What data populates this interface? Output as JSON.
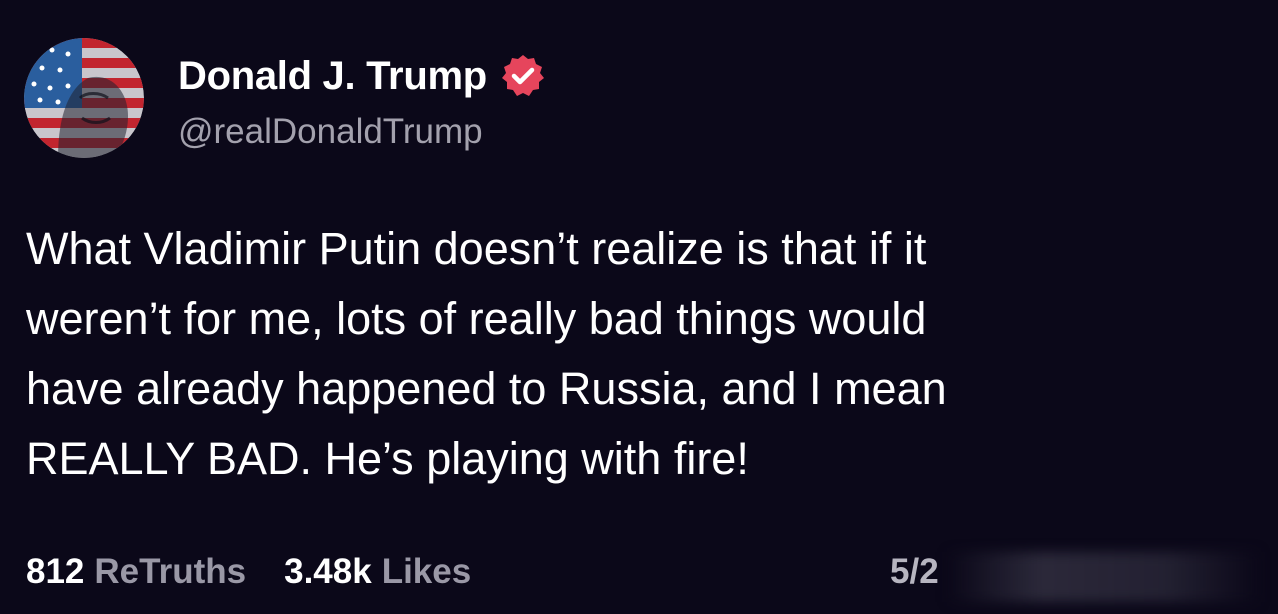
{
  "author": {
    "display_name": "Donald J. Trump",
    "handle": "@realDonaldTrump",
    "avatar_icon": "flag-portrait-avatar",
    "verified_icon": "verified-badge-icon",
    "verified_color": "#e6455c"
  },
  "post": {
    "lines": [
      "What Vladimir Putin doesn’t realize is that if it",
      "weren’t for me, lots of really bad things would",
      "have already happened to Russia, and I mean",
      "REALLY BAD. He’s playing with fire!"
    ]
  },
  "stats": {
    "retruths_count": "812",
    "retruths_label": "ReTruths",
    "likes_count": "3.48k",
    "likes_label": "Likes",
    "timestamp": "5/2"
  },
  "colors": {
    "background": "#0b0819",
    "text": "#ffffff",
    "muted": "#a3a1ad"
  }
}
